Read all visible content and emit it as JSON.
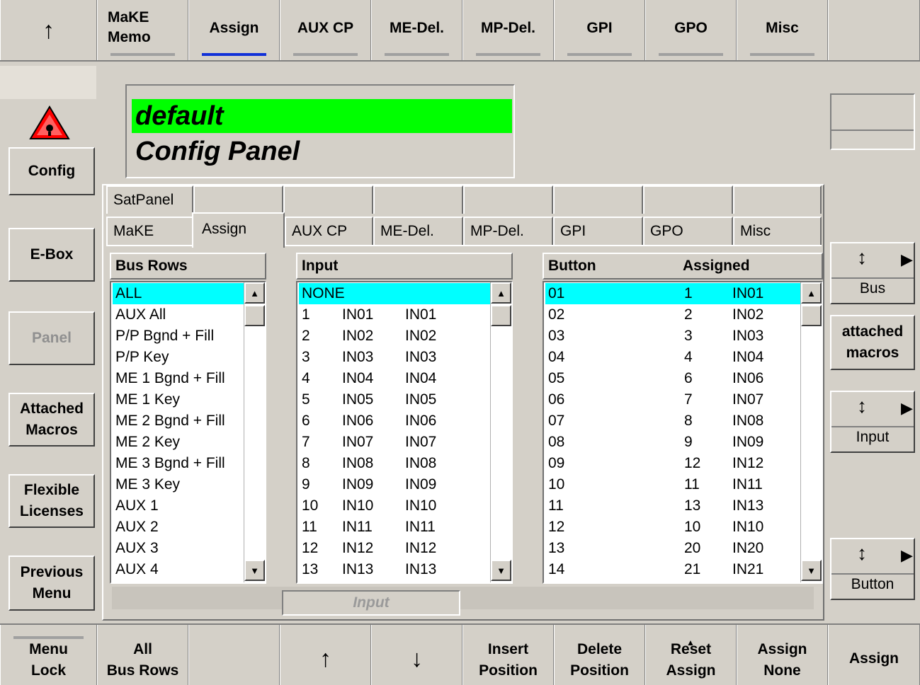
{
  "top_bar": {
    "back_arrow": "↑",
    "tabs": [
      {
        "label": "MaKE\nMemo"
      },
      {
        "label": "Assign"
      },
      {
        "label": "AUX CP"
      },
      {
        "label": "ME-Del."
      },
      {
        "label": "MP-Del."
      },
      {
        "label": "GPI"
      },
      {
        "label": "GPO"
      },
      {
        "label": "Misc"
      }
    ],
    "selected_tab": "Assign"
  },
  "display": {
    "name": "default",
    "panel": "Config Panel"
  },
  "left_menu": {
    "config": "Config",
    "ebox": "E-Box",
    "panel": "Panel",
    "attached_macros": "Attached\nMacros",
    "flexible_licenses": "Flexible\nLicenses",
    "previous_menu": "Previous\nMenu",
    "menu_lock": "Menu\nLock"
  },
  "tabs_row1": [
    "SatPanel",
    "",
    "",
    "",
    "",
    "",
    "",
    ""
  ],
  "tabs_row2": [
    "MaKE",
    "Assign",
    "AUX CP",
    "ME-Del.",
    "MP-Del.",
    "GPI",
    "GPO",
    "Misc"
  ],
  "bus_rows": {
    "header": "Bus Rows",
    "items": [
      "ALL",
      "AUX All",
      "P/P Bgnd + Fill",
      "P/P Key",
      "ME 1 Bgnd + Fill",
      "ME 1 Key",
      "ME 2 Bgnd + Fill",
      "ME 2 Key",
      "ME 3 Bgnd + Fill",
      "ME 3 Key",
      "AUX 1",
      "AUX 2",
      "AUX 3",
      "AUX 4"
    ],
    "selected": 0
  },
  "input": {
    "header": "Input",
    "first": "NONE",
    "rows": [
      [
        "1",
        "IN01",
        "IN01"
      ],
      [
        "2",
        "IN02",
        "IN02"
      ],
      [
        "3",
        "IN03",
        "IN03"
      ],
      [
        "4",
        "IN04",
        "IN04"
      ],
      [
        "5",
        "IN05",
        "IN05"
      ],
      [
        "6",
        "IN06",
        "IN06"
      ],
      [
        "7",
        "IN07",
        "IN07"
      ],
      [
        "8",
        "IN08",
        "IN08"
      ],
      [
        "9",
        "IN09",
        "IN09"
      ],
      [
        "10",
        "IN10",
        "IN10"
      ],
      [
        "11",
        "IN11",
        "IN11"
      ],
      [
        "12",
        "IN12",
        "IN12"
      ],
      [
        "13",
        "IN13",
        "IN13"
      ]
    ]
  },
  "buttons": {
    "header_button": "Button",
    "header_assigned": "Assigned",
    "rows": [
      [
        "01",
        "1",
        "IN01"
      ],
      [
        "02",
        "2",
        "IN02"
      ],
      [
        "03",
        "3",
        "IN03"
      ],
      [
        "04",
        "4",
        "IN04"
      ],
      [
        "05",
        "6",
        "IN06"
      ],
      [
        "06",
        "7",
        "IN07"
      ],
      [
        "07",
        "8",
        "IN08"
      ],
      [
        "08",
        "9",
        "IN09"
      ],
      [
        "09",
        "12",
        "IN12"
      ],
      [
        "10",
        "11",
        "IN11"
      ],
      [
        "11",
        "13",
        "IN13"
      ],
      [
        "12",
        "10",
        "IN10"
      ],
      [
        "13",
        "20",
        "IN20"
      ],
      [
        "14",
        "21",
        "IN21"
      ]
    ],
    "selected": 0
  },
  "input_field_label": "Input",
  "right_panel": {
    "bus": "Bus",
    "attached_macros": "attached\nmacros",
    "input": "Input",
    "button": "Button"
  },
  "bottom_bar": {
    "all_bus_rows": "All\nBus Rows",
    "insert_position": "Insert\nPosition",
    "delete_position": "Delete\nPosition",
    "reset_assign": "Reset\nAssign",
    "assign_none": "Assign\nNone",
    "assign": "Assign"
  },
  "colors": {
    "background": "#d4d0c8",
    "highlight": "#00ffff",
    "name_field": "#00ff00",
    "selected_tab_underline": "#1030d8"
  }
}
